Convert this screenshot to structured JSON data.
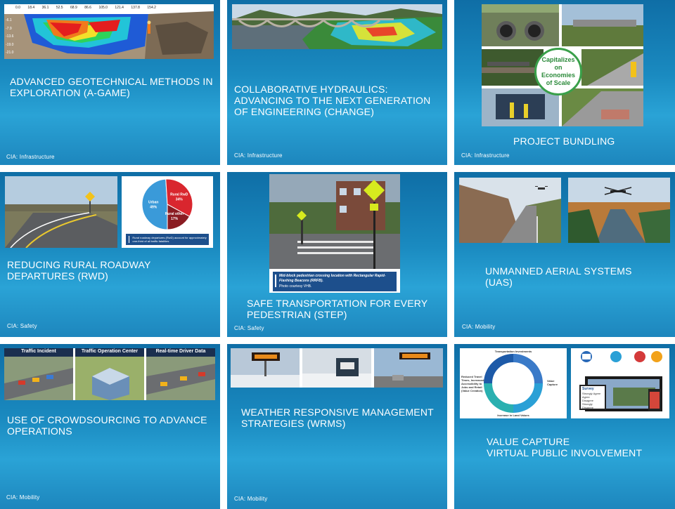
{
  "tiles": [
    {
      "title": "ADVANCED GEOTECHNICAL METHODS IN EXPLORATION (A-GaME)",
      "category": "CIA: Infrastructure"
    },
    {
      "title": "COLLABORATIVE HYDRAULICS: ADVANCING TO THE NEXT GENERATION OF ENGINEERING (CHANGE)",
      "category": "CIA: Infrastructure"
    },
    {
      "title": "PROJECT BUNDLING",
      "category": "CIA: Infrastructure"
    },
    {
      "title": "REDUCING RURAL ROADWAY DEPARTURES (RWD)",
      "category": "CIA: Safety"
    },
    {
      "title": "SAFE TRANSPORTATION FOR EVERY PEDESTRIAN (STEP)",
      "category": "CIA: Safety"
    },
    {
      "title": "UNMANNED AERIAL SYSTEMS (UAS)",
      "category": "CIA: Mobility"
    },
    {
      "title": "USE OF CROWDSOURCING TO ADVANCE OPERATIONS",
      "category": "CIA: Mobility"
    },
    {
      "title": "WEATHER RESPONSIVE MANAGEMENT STRATEGIES (WRMS)",
      "category": "CIA: Mobility"
    },
    {
      "title": "VALUE CAPTURE\nVIRTUAL PUBLIC INVOLVEMENT",
      "category": ""
    }
  ],
  "geo_profile": {
    "x_ticks": [
      "0.0",
      "18.4",
      "36.1",
      "52.5",
      "68.9",
      "86.6",
      "105.0",
      "121.4",
      "137.8",
      "154.2"
    ],
    "y_ticks": [
      "-6.1",
      "-7.9",
      "-13.6",
      "-19.0",
      "-21.0"
    ]
  },
  "bundling_badge": "Capitalizes on Economies of Scale",
  "rwd_pie": {
    "slices": [
      {
        "label": "Urban",
        "value": "49%",
        "pct": 49,
        "color": "#3a9ad9"
      },
      {
        "label": "Rural RwD",
        "value": "34%",
        "pct": 34,
        "color": "#d9262e"
      },
      {
        "label": "Rural other",
        "value": "17%",
        "pct": 17,
        "color": "#8a1c22"
      }
    ],
    "caption": "Rural roadway departures (RwD) account for approximately one-third of all traffic fatalities"
  },
  "step_caption": {
    "line1": "Mid-block pedestrian crossing location with Rectangular Rapid-Flashing Beacons (RRFB).",
    "line2": "Photo courtesy VHB."
  },
  "crowd_panels": [
    "Traffic Incident",
    "Traffic Operation Center",
    "Real-time Driver Data"
  ],
  "value_capture": {
    "top": "Transportation Investments",
    "right": "Value Capture",
    "bottom": "Increase in Land Values",
    "left": "Reduced Travel Times, Increased Accessibility to Jobs and Retail (Value Creation)"
  },
  "vpi_survey": {
    "title": "Survey",
    "options": [
      "Strongly Agree",
      "Agree",
      "Disagree",
      "Strongly Disagree"
    ]
  }
}
